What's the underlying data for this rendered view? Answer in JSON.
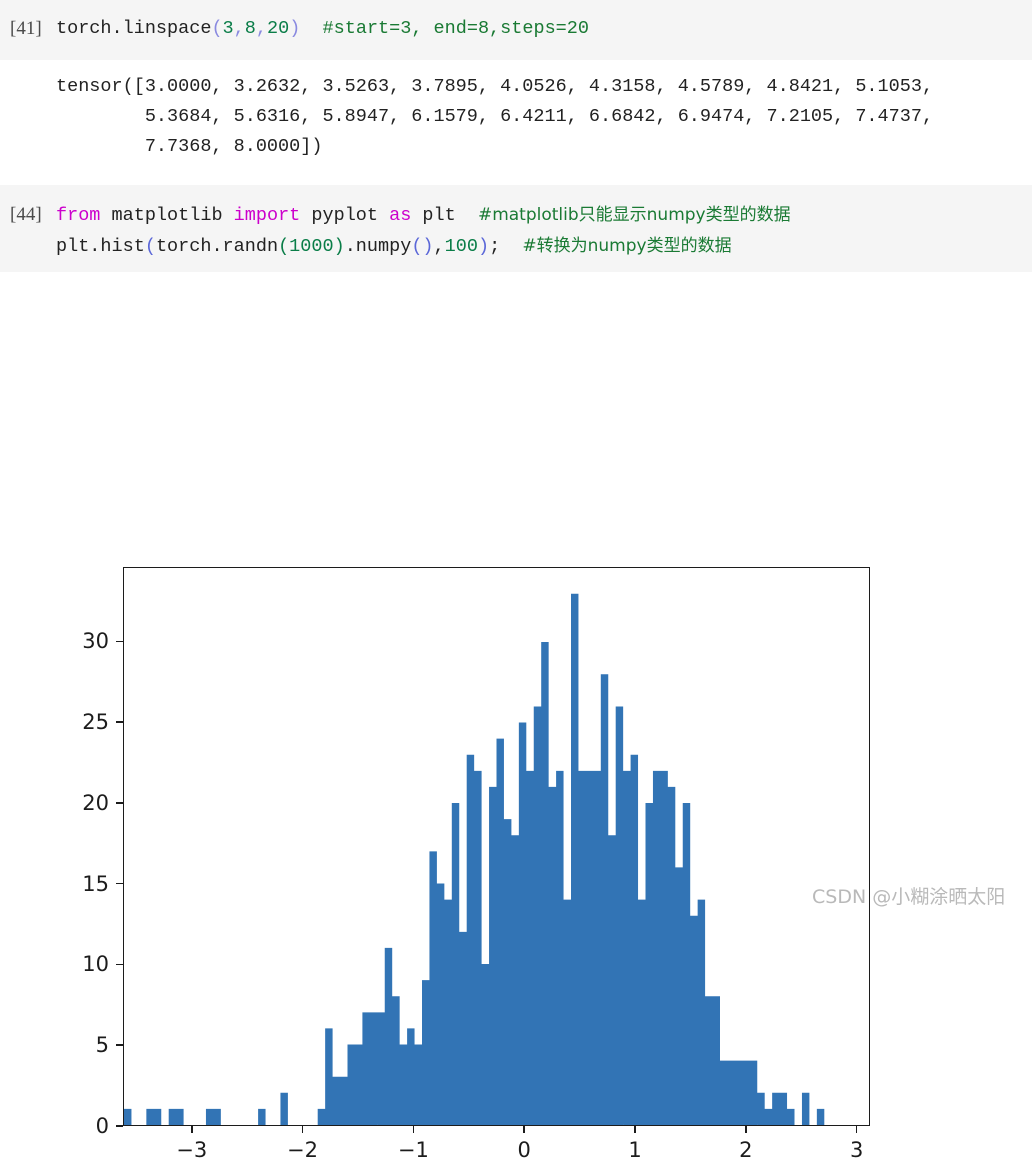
{
  "cells": [
    {
      "prompt": "[41]",
      "code_plain": "torch.linspace(3,8,20)  #start=3, end=8,steps=20",
      "code_tokens": [
        {
          "t": "torch.linspace",
          "c": "plain"
        },
        {
          "t": "(",
          "c": "par"
        },
        {
          "t": "3",
          "c": "num"
        },
        {
          "t": ",",
          "c": "par"
        },
        {
          "t": "8",
          "c": "num"
        },
        {
          "t": ",",
          "c": "par"
        },
        {
          "t": "20",
          "c": "num"
        },
        {
          "t": ")",
          "c": "par"
        },
        {
          "t": "  ",
          "c": "plain"
        },
        {
          "t": "#start=3, end=8,steps=20",
          "c": "cmt"
        }
      ],
      "output_lines": [
        "tensor([3.0000, 3.2632, 3.5263, 3.7895, 4.0526, 4.3158, 4.5789, 4.8421, 5.1053,",
        "        5.3684, 5.6316, 5.8947, 6.1579, 6.4211, 6.6842, 6.9474, 7.2105, 7.4737,",
        "        7.7368, 8.0000])"
      ]
    },
    {
      "prompt": "[44]",
      "code_plain": "from matplotlib import pyplot as plt  #matplotlib只能显示numpy类型的数据\nplt.hist(torch.randn(1000).numpy(),100);  #转换为numpy类型的数据",
      "line1_tokens": [
        {
          "t": "from",
          "c": "kw"
        },
        {
          "t": " matplotlib ",
          "c": "plain"
        },
        {
          "t": "import",
          "c": "kw"
        },
        {
          "t": " pyplot ",
          "c": "plain"
        },
        {
          "t": "as",
          "c": "kw"
        },
        {
          "t": " plt  ",
          "c": "plain"
        },
        {
          "t": "#matplotlib只能显示numpy类型的数据",
          "c": "cmt"
        }
      ],
      "line2_tokens": [
        {
          "t": "plt.hist",
          "c": "plain"
        },
        {
          "t": "(",
          "c": "par2"
        },
        {
          "t": "torch.randn",
          "c": "plain"
        },
        {
          "t": "(",
          "c": "num"
        },
        {
          "t": "1000",
          "c": "num"
        },
        {
          "t": ")",
          "c": "num"
        },
        {
          "t": ".numpy",
          "c": "plain"
        },
        {
          "t": "()",
          "c": "par2"
        },
        {
          "t": ",",
          "c": "plain"
        },
        {
          "t": "100",
          "c": "num"
        },
        {
          "t": ")",
          "c": "par2"
        },
        {
          "t": ";  ",
          "c": "plain"
        },
        {
          "t": "#转换为numpy类型的数据",
          "c": "cmt"
        }
      ]
    }
  ],
  "watermark": "CSDN @小糊涂晒太阳",
  "colors": {
    "bar": "#3274b5",
    "cell_background": "#f5f5f5",
    "axis": "#1c1c1c",
    "keyword": "#cc00cc",
    "number": "#0a7d48",
    "comment": "#1a7a34",
    "watermark": "#b9b9b9"
  },
  "chart_data": {
    "type": "bar",
    "title": "",
    "xlabel": "",
    "ylabel": "",
    "xlim": [
      -3.62,
      3.12
    ],
    "ylim": [
      0,
      34.6
    ],
    "grid": false,
    "legend": null,
    "bins": 100,
    "xticks": [
      -3,
      -2,
      -1,
      0,
      1,
      2,
      3
    ],
    "yticks": [
      0,
      5,
      10,
      15,
      20,
      25,
      30
    ],
    "bin_edges_note": "100 equal-width bins spanning the data range of 1000 standard-normal samples",
    "values": [
      1,
      0,
      0,
      1,
      1,
      0,
      1,
      1,
      0,
      0,
      0,
      1,
      1,
      0,
      0,
      0,
      0,
      0,
      1,
      0,
      0,
      2,
      0,
      0,
      0,
      0,
      1,
      6,
      3,
      3,
      5,
      5,
      7,
      7,
      7,
      11,
      8,
      5,
      6,
      5,
      9,
      17,
      15,
      14,
      20,
      12,
      23,
      22,
      10,
      21,
      24,
      19,
      18,
      25,
      22,
      26,
      30,
      21,
      22,
      14,
      33,
      22,
      22,
      22,
      28,
      18,
      26,
      22,
      23,
      14,
      20,
      22,
      22,
      21,
      16,
      20,
      13,
      14,
      8,
      8,
      4,
      4,
      4,
      4,
      4,
      2,
      1,
      2,
      2,
      1,
      0,
      2,
      0,
      1,
      0,
      0,
      0,
      0,
      0,
      0
    ]
  }
}
